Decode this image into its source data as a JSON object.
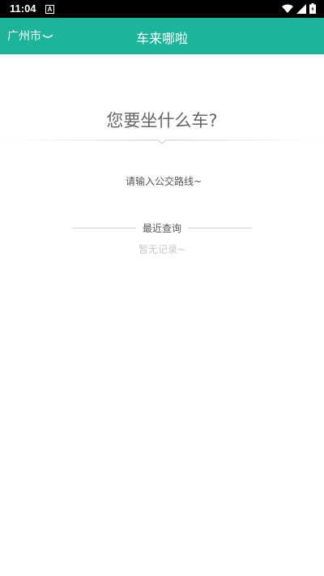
{
  "status_bar": {
    "time": "11:04",
    "notification_icon": "A"
  },
  "header": {
    "city": "广州市",
    "title": "车来哪啦"
  },
  "main": {
    "prompt": "您要坐什么车?",
    "search_placeholder": "请输入公交路线~",
    "recent": {
      "title": "最近查询",
      "empty_text": "暂无记录~"
    }
  },
  "colors": {
    "accent": "#1db59a",
    "status_bar": "#000000"
  }
}
